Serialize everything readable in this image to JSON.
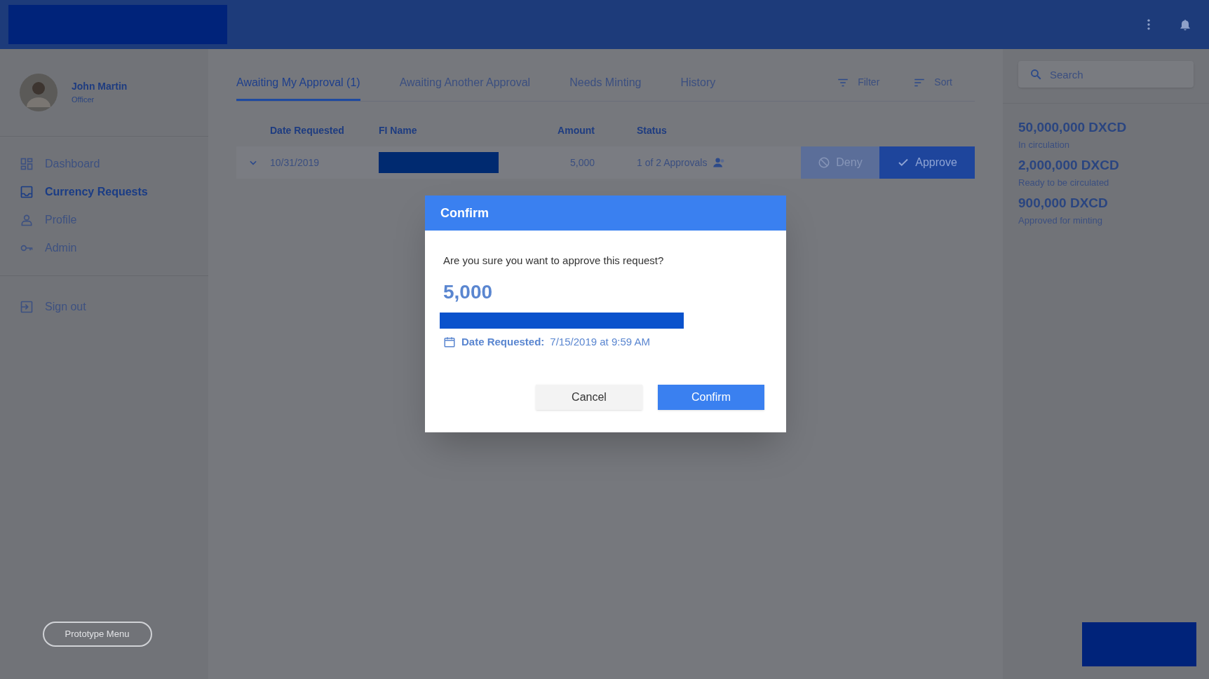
{
  "user": {
    "name": "John Martin",
    "role": "Officer"
  },
  "nav": [
    {
      "label": "Dashboard",
      "kind": "grid",
      "selected": false
    },
    {
      "label": "Currency Requests",
      "kind": "inbox",
      "selected": true
    },
    {
      "label": "Profile",
      "kind": "person",
      "selected": false
    },
    {
      "label": "Admin",
      "kind": "key",
      "selected": false
    }
  ],
  "sign_out": "Sign out",
  "prototype_menu": "Prototype Menu",
  "tabs": [
    {
      "label": "Awaiting My Approval (1)",
      "selected": true
    },
    {
      "label": "Awaiting Another Approval",
      "selected": false
    },
    {
      "label": "Needs Minting",
      "selected": false
    },
    {
      "label": "History",
      "selected": false
    }
  ],
  "filter": "Filter",
  "sort": "Sort",
  "table": {
    "columns": [
      "Date Requested",
      "FI Name",
      "Amount",
      "Status"
    ],
    "rows": [
      {
        "date": "10/31/2019",
        "amount": "5,000",
        "status": "1 of 2 Approvals"
      }
    ]
  },
  "row_actions": {
    "deny": "Deny",
    "approve": "Approve"
  },
  "search": {
    "placeholder": "Search"
  },
  "stats": [
    {
      "value": "50,000,000 DXCD",
      "label": "In circulation"
    },
    {
      "value": "2,000,000 DXCD",
      "label": "Ready to be circulated"
    },
    {
      "value": "900,000 DXCD",
      "label": "Approved for minting"
    }
  ],
  "dialog": {
    "title": "Confirm",
    "message": "Are you sure you want to approve this request?",
    "amount": "5,000",
    "date_label": "Date Requested:",
    "date_value": "7/15/2019 at 9:59 AM",
    "cancel": "Cancel",
    "confirm": "Confirm"
  }
}
